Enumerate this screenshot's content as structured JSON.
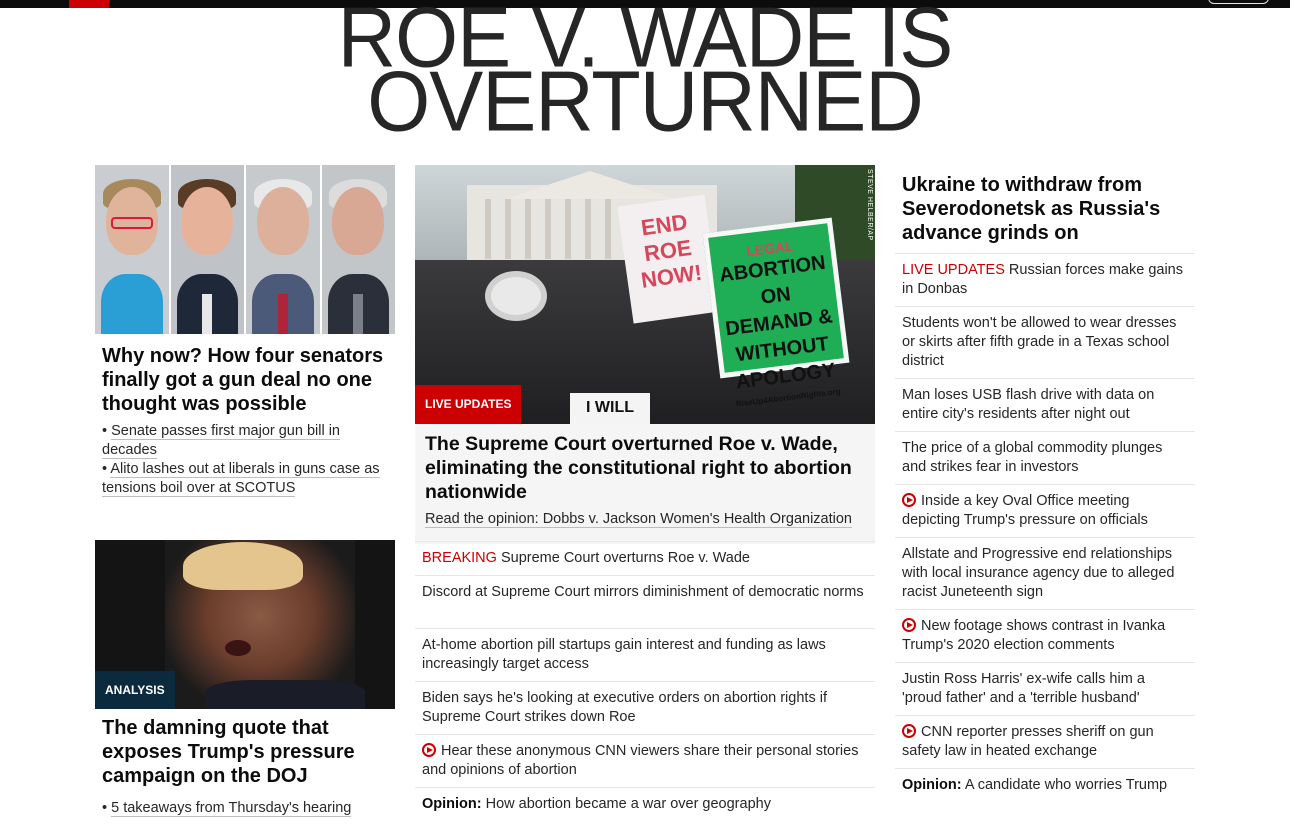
{
  "header": {
    "headline_line1": "ROE V. WADE IS",
    "headline_line2": "OVERTURNED"
  },
  "left": {
    "story1": {
      "title": "Why now? How four senators finally got a gun deal no one thought was possible",
      "bullets": [
        "Senate passes first major gun bill in decades",
        "Alito lashes out at liberals in guns case as tensions boil over at SCOTUS"
      ]
    },
    "story2": {
      "tag": "ANALYSIS",
      "title": "The damning quote that exposes Trump's pressure campaign on the DOJ",
      "bullets": [
        "5 takeaways from Thursday's hearing"
      ]
    }
  },
  "center": {
    "hero": {
      "tag": "LIVE UPDATES",
      "credit": "STEVE HELBER/AP",
      "sign_white": "END ROE NOW!",
      "sign_green_top": "LEGAL",
      "sign_green": "ABORTION ON DEMAND & WITHOUT APOLOGY",
      "sign_green_url": "RiseUp4AbortionRights.org",
      "sign_bottom": "I WILL",
      "title": "The Supreme Court overturned Roe v. Wade, eliminating the constitutional right to abortion nationwide",
      "sub": "Read the opinion: Dobbs v. Jackson Women's Health Organization"
    },
    "list": [
      {
        "prefix": "BREAKING",
        "text": "Supreme Court overturns Roe v. Wade"
      },
      {
        "prefix": "",
        "text": "Discord at Supreme Court mirrors diminishment of democratic norms"
      },
      {
        "prefix": "",
        "text": "At-home abortion pill startups gain interest and funding as laws increasingly target access"
      },
      {
        "prefix": "",
        "text": "Biden says he's looking at executive orders on abortion rights if Supreme Court strikes down Roe"
      },
      {
        "prefix": "",
        "text": "Hear these anonymous CNN viewers share their personal stories and opinions of abortion",
        "video": true
      },
      {
        "prefix": "Opinion:",
        "text": "How abortion became a war over geography"
      }
    ]
  },
  "right": {
    "title": "Ukraine to withdraw from Severodonetsk as Russia's advance grinds on",
    "list": [
      {
        "prefix": "LIVE UPDATES",
        "text": "Russian forces make gains in Donbas"
      },
      {
        "prefix": "",
        "text": "Students won't be allowed to wear dresses or skirts after fifth grade in a Texas school district"
      },
      {
        "prefix": "",
        "text": "Man loses USB flash drive with data on entire city's residents after night out"
      },
      {
        "prefix": "",
        "text": "The price of a global commodity plunges and strikes fear in investors"
      },
      {
        "prefix": "",
        "text": "Inside a key Oval Office meeting depicting Trump's pressure on officials",
        "video": true
      },
      {
        "prefix": "",
        "text": "Allstate and Progressive end relationships with local insurance agency due to alleged racist Juneteenth sign"
      },
      {
        "prefix": "",
        "text": "New footage shows contrast in Ivanka Trump's 2020 election comments",
        "video": true
      },
      {
        "prefix": "",
        "text": "Justin Ross Harris' ex-wife calls him a 'proud father' and a 'terrible husband'"
      },
      {
        "prefix": "",
        "text": "CNN reporter presses sheriff on gun safety law in heated exchange",
        "video": true
      },
      {
        "prefix": "Opinion:",
        "text": "A candidate who worries Trump"
      }
    ]
  },
  "colors": {
    "accent_red": "#cc0000",
    "analysis_bg": "#0c2a3e",
    "text": "#0c0c0c"
  }
}
